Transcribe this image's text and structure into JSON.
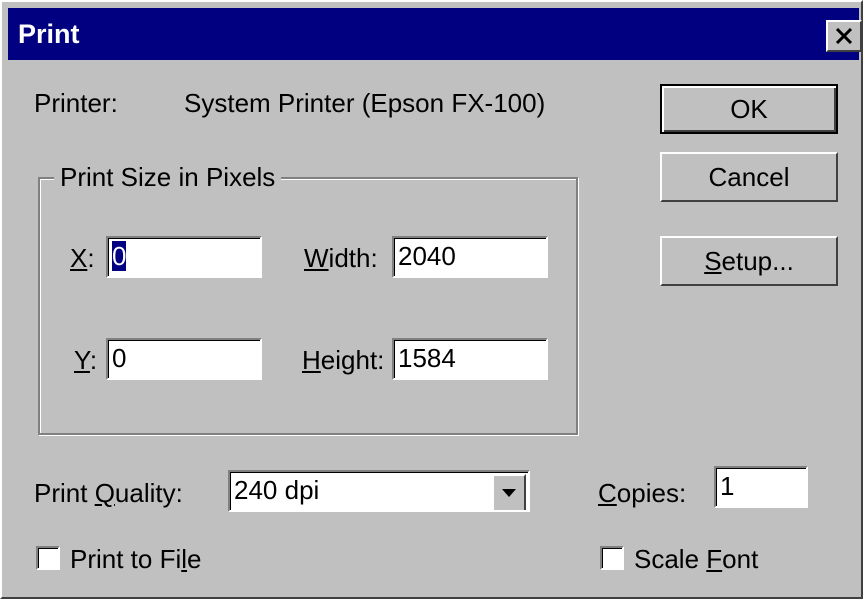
{
  "window": {
    "title": "Print"
  },
  "printer": {
    "label": "Printer:",
    "value": "System Printer (Epson FX-100)"
  },
  "buttons": {
    "ok": "OK",
    "cancel": "Cancel",
    "setup_mnemonic": "S",
    "setup_rest": "etup..."
  },
  "print_size": {
    "legend": "Print Size in Pixels",
    "x": {
      "mnemonic": "X",
      "suffix": ":",
      "value": "0"
    },
    "y": {
      "mnemonic": "Y",
      "suffix": ":",
      "value": "0"
    },
    "width": {
      "mnemonic": "W",
      "rest": "idth:",
      "value": "2040"
    },
    "height": {
      "mnemonic": "H",
      "rest": "eight:",
      "value": "1584"
    }
  },
  "print_quality": {
    "prefix": "Print ",
    "mnemonic": "Q",
    "rest": "uality:",
    "selected": "240 dpi"
  },
  "copies": {
    "mnemonic": "C",
    "rest": "opies:",
    "value": "1"
  },
  "print_to_file": {
    "prefix": "Print to Fi",
    "mnemonic": "l",
    "rest": "e",
    "checked": false
  },
  "scale_font": {
    "prefix": "Scale ",
    "mnemonic": "F",
    "rest": "ont",
    "checked": false
  },
  "icons": {
    "close": "close-icon",
    "dropdown": "chevron-down-icon"
  }
}
